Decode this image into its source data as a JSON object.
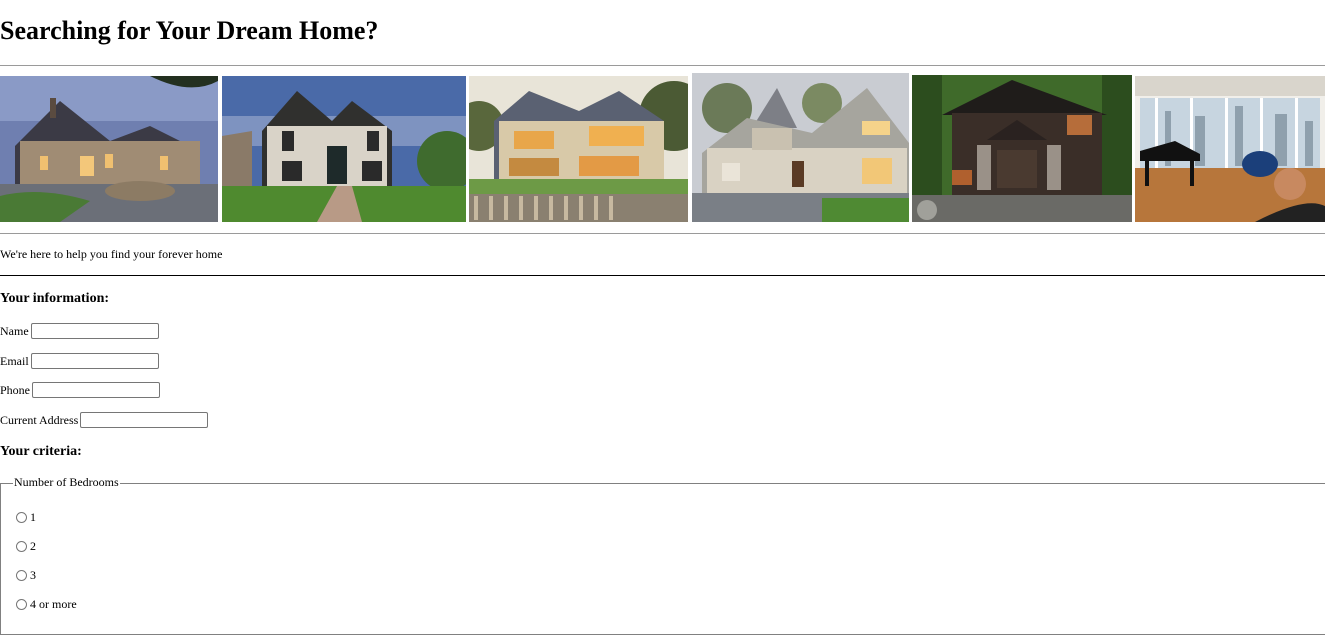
{
  "page": {
    "title": "Searching for Your Dream Home?",
    "tagline": "We're here to help you find your forever home"
  },
  "gallery": {
    "photos": [
      {
        "alt": "stone-manor-photo"
      },
      {
        "alt": "modern-stone-house-photo"
      },
      {
        "alt": "lakefront-house-photo"
      },
      {
        "alt": "turret-cottage-photo"
      },
      {
        "alt": "forest-lodge-photo"
      },
      {
        "alt": "penthouse-piano-photo"
      }
    ]
  },
  "info": {
    "heading": "Your information:",
    "name_label": "Name",
    "name_value": "",
    "email_label": "Email",
    "email_value": "",
    "phone_label": "Phone",
    "phone_value": "",
    "address_label": "Current Address",
    "address_value": ""
  },
  "criteria": {
    "heading": "Your criteria:",
    "bedrooms_legend": "Number of Bedrooms",
    "bedroom_options": [
      "1",
      "2",
      "3",
      "4 or more"
    ]
  }
}
